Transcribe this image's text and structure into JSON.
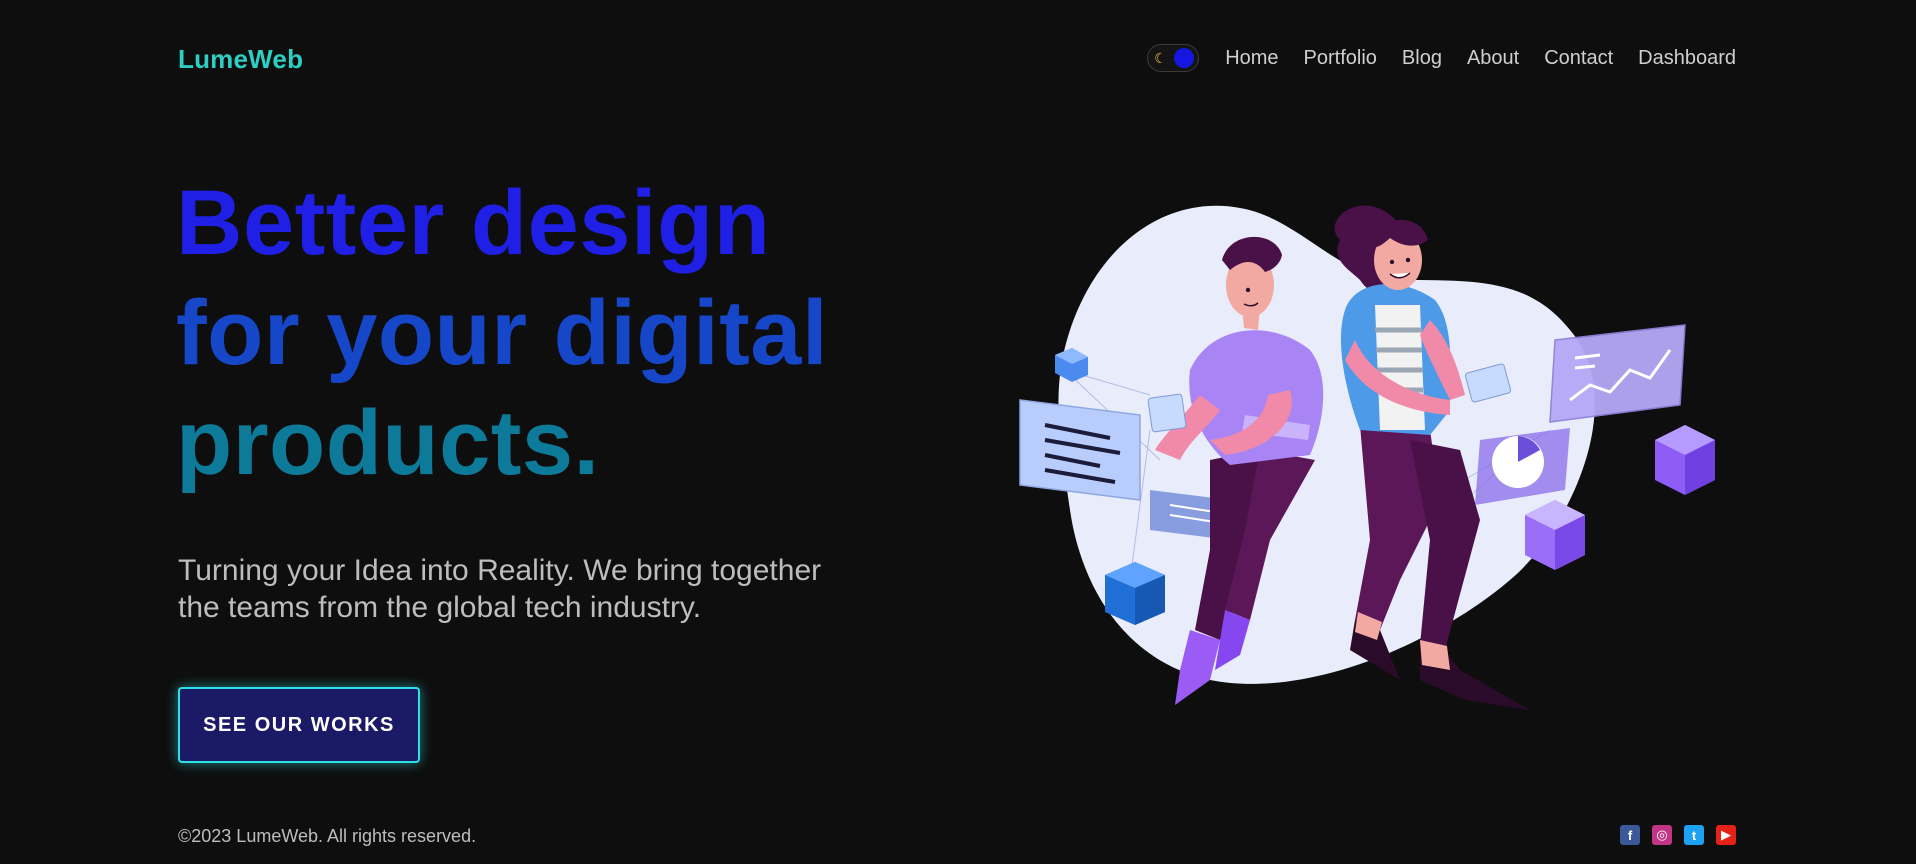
{
  "header": {
    "logo": "LumeWeb",
    "nav": [
      "Home",
      "Portfolio",
      "Blog",
      "About",
      "Contact",
      "Dashboard"
    ],
    "theme_toggle_icon": "moon-icon"
  },
  "hero": {
    "headline": [
      "Better design",
      "for your digital",
      "products."
    ],
    "subtitle_line1": "Turning your Idea into Reality. We bring together",
    "subtitle_line2": "the teams from the global tech industry.",
    "cta": "SEE OUR WORKS",
    "illustration": "two-people-with-devices-illustration"
  },
  "footer": {
    "copyright": "©2023 LumeWeb. All rights reserved.",
    "socials": [
      "facebook-icon",
      "instagram-icon",
      "twitter-icon",
      "youtube-icon"
    ]
  },
  "colors": {
    "background": "#0e0e0e",
    "accent": "#2ecfc2",
    "headline_blue": "#1f1fe6",
    "headline_teal": "#0e7a9a",
    "cta_bg": "#1a1a66"
  }
}
